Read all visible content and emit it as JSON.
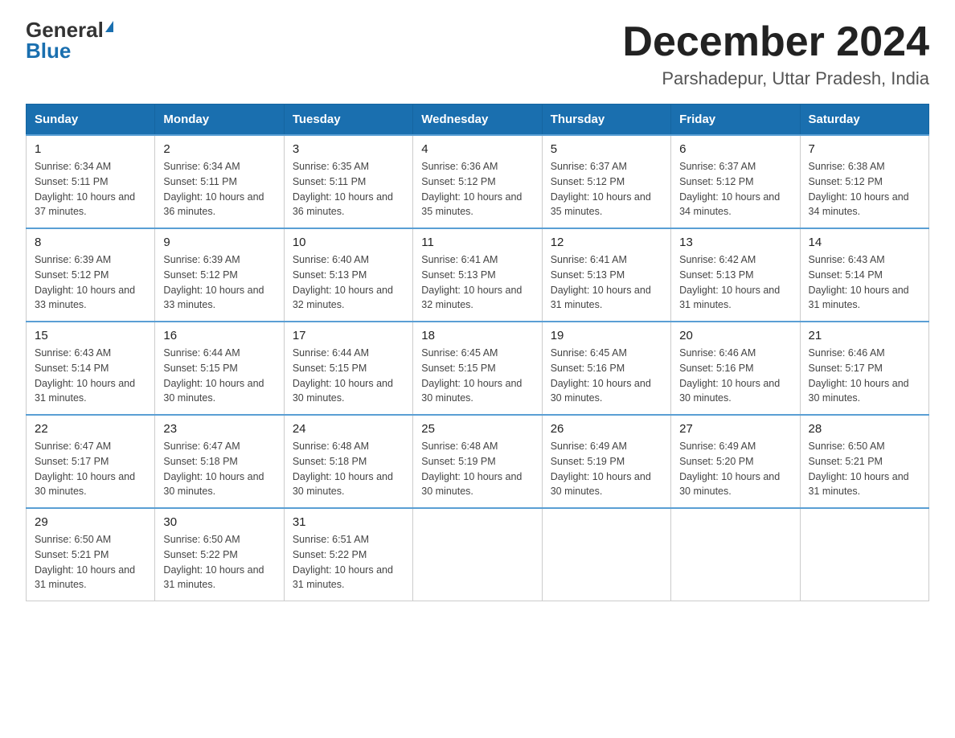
{
  "header": {
    "logo_general": "General",
    "logo_blue": "Blue",
    "month_title": "December 2024",
    "location": "Parshadepur, Uttar Pradesh, India"
  },
  "columns": [
    "Sunday",
    "Monday",
    "Tuesday",
    "Wednesday",
    "Thursday",
    "Friday",
    "Saturday"
  ],
  "weeks": [
    [
      {
        "day": "1",
        "sunrise": "6:34 AM",
        "sunset": "5:11 PM",
        "daylight": "10 hours and 37 minutes."
      },
      {
        "day": "2",
        "sunrise": "6:34 AM",
        "sunset": "5:11 PM",
        "daylight": "10 hours and 36 minutes."
      },
      {
        "day": "3",
        "sunrise": "6:35 AM",
        "sunset": "5:11 PM",
        "daylight": "10 hours and 36 minutes."
      },
      {
        "day": "4",
        "sunrise": "6:36 AM",
        "sunset": "5:12 PM",
        "daylight": "10 hours and 35 minutes."
      },
      {
        "day": "5",
        "sunrise": "6:37 AM",
        "sunset": "5:12 PM",
        "daylight": "10 hours and 35 minutes."
      },
      {
        "day": "6",
        "sunrise": "6:37 AM",
        "sunset": "5:12 PM",
        "daylight": "10 hours and 34 minutes."
      },
      {
        "day": "7",
        "sunrise": "6:38 AM",
        "sunset": "5:12 PM",
        "daylight": "10 hours and 34 minutes."
      }
    ],
    [
      {
        "day": "8",
        "sunrise": "6:39 AM",
        "sunset": "5:12 PM",
        "daylight": "10 hours and 33 minutes."
      },
      {
        "day": "9",
        "sunrise": "6:39 AM",
        "sunset": "5:12 PM",
        "daylight": "10 hours and 33 minutes."
      },
      {
        "day": "10",
        "sunrise": "6:40 AM",
        "sunset": "5:13 PM",
        "daylight": "10 hours and 32 minutes."
      },
      {
        "day": "11",
        "sunrise": "6:41 AM",
        "sunset": "5:13 PM",
        "daylight": "10 hours and 32 minutes."
      },
      {
        "day": "12",
        "sunrise": "6:41 AM",
        "sunset": "5:13 PM",
        "daylight": "10 hours and 31 minutes."
      },
      {
        "day": "13",
        "sunrise": "6:42 AM",
        "sunset": "5:13 PM",
        "daylight": "10 hours and 31 minutes."
      },
      {
        "day": "14",
        "sunrise": "6:43 AM",
        "sunset": "5:14 PM",
        "daylight": "10 hours and 31 minutes."
      }
    ],
    [
      {
        "day": "15",
        "sunrise": "6:43 AM",
        "sunset": "5:14 PM",
        "daylight": "10 hours and 31 minutes."
      },
      {
        "day": "16",
        "sunrise": "6:44 AM",
        "sunset": "5:15 PM",
        "daylight": "10 hours and 30 minutes."
      },
      {
        "day": "17",
        "sunrise": "6:44 AM",
        "sunset": "5:15 PM",
        "daylight": "10 hours and 30 minutes."
      },
      {
        "day": "18",
        "sunrise": "6:45 AM",
        "sunset": "5:15 PM",
        "daylight": "10 hours and 30 minutes."
      },
      {
        "day": "19",
        "sunrise": "6:45 AM",
        "sunset": "5:16 PM",
        "daylight": "10 hours and 30 minutes."
      },
      {
        "day": "20",
        "sunrise": "6:46 AM",
        "sunset": "5:16 PM",
        "daylight": "10 hours and 30 minutes."
      },
      {
        "day": "21",
        "sunrise": "6:46 AM",
        "sunset": "5:17 PM",
        "daylight": "10 hours and 30 minutes."
      }
    ],
    [
      {
        "day": "22",
        "sunrise": "6:47 AM",
        "sunset": "5:17 PM",
        "daylight": "10 hours and 30 minutes."
      },
      {
        "day": "23",
        "sunrise": "6:47 AM",
        "sunset": "5:18 PM",
        "daylight": "10 hours and 30 minutes."
      },
      {
        "day": "24",
        "sunrise": "6:48 AM",
        "sunset": "5:18 PM",
        "daylight": "10 hours and 30 minutes."
      },
      {
        "day": "25",
        "sunrise": "6:48 AM",
        "sunset": "5:19 PM",
        "daylight": "10 hours and 30 minutes."
      },
      {
        "day": "26",
        "sunrise": "6:49 AM",
        "sunset": "5:19 PM",
        "daylight": "10 hours and 30 minutes."
      },
      {
        "day": "27",
        "sunrise": "6:49 AM",
        "sunset": "5:20 PM",
        "daylight": "10 hours and 30 minutes."
      },
      {
        "day": "28",
        "sunrise": "6:50 AM",
        "sunset": "5:21 PM",
        "daylight": "10 hours and 31 minutes."
      }
    ],
    [
      {
        "day": "29",
        "sunrise": "6:50 AM",
        "sunset": "5:21 PM",
        "daylight": "10 hours and 31 minutes."
      },
      {
        "day": "30",
        "sunrise": "6:50 AM",
        "sunset": "5:22 PM",
        "daylight": "10 hours and 31 minutes."
      },
      {
        "day": "31",
        "sunrise": "6:51 AM",
        "sunset": "5:22 PM",
        "daylight": "10 hours and 31 minutes."
      },
      null,
      null,
      null,
      null
    ]
  ]
}
